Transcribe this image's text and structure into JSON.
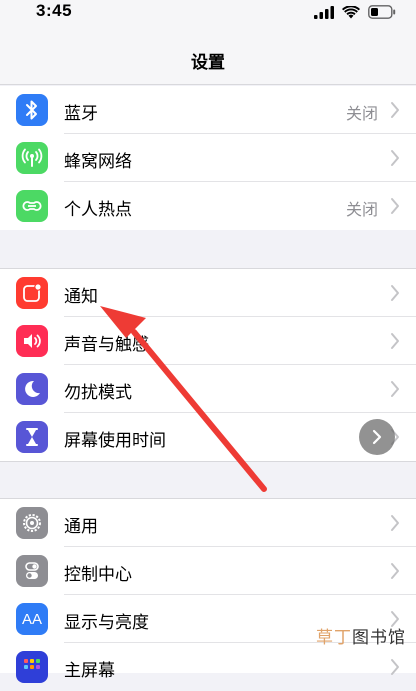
{
  "status_bar": {
    "time": "3:45"
  },
  "nav": {
    "title": "设置"
  },
  "groups": [
    {
      "rows": [
        {
          "label": "蓝牙",
          "value": "关闭",
          "icon": "bluetooth-icon",
          "color": "#2f7cf6"
        },
        {
          "label": "蜂窝网络",
          "value": "",
          "icon": "cellular-icon",
          "color": "#4cd964"
        },
        {
          "label": "个人热点",
          "value": "关闭",
          "icon": "hotspot-icon",
          "color": "#4cd964"
        }
      ]
    },
    {
      "rows": [
        {
          "label": "通知",
          "value": "",
          "icon": "notifications-icon",
          "color": "#ff3b30"
        },
        {
          "label": "声音与触感",
          "value": "",
          "icon": "sound-icon",
          "color": "#ff2d55"
        },
        {
          "label": "勿扰模式",
          "value": "",
          "icon": "moon-icon",
          "color": "#5856d6"
        },
        {
          "label": "屏幕使用时间",
          "value": "",
          "icon": "hourglass-icon",
          "color": "#5856d6"
        }
      ]
    },
    {
      "rows": [
        {
          "label": "通用",
          "value": "",
          "icon": "gear-icon",
          "color": "#8e8e93"
        },
        {
          "label": "控制中心",
          "value": "",
          "icon": "toggles-icon",
          "color": "#8e8e93"
        },
        {
          "label": "显示与亮度",
          "value": "",
          "icon": "display-icon",
          "color": "#2f7cf6"
        },
        {
          "label": "主屏幕",
          "value": "",
          "icon": "home-screen-icon",
          "color": "#2f7cf6"
        }
      ]
    }
  ],
  "display_icon_text": "AA",
  "watermark": {
    "part1": "草丁",
    "part2": "图书馆"
  }
}
